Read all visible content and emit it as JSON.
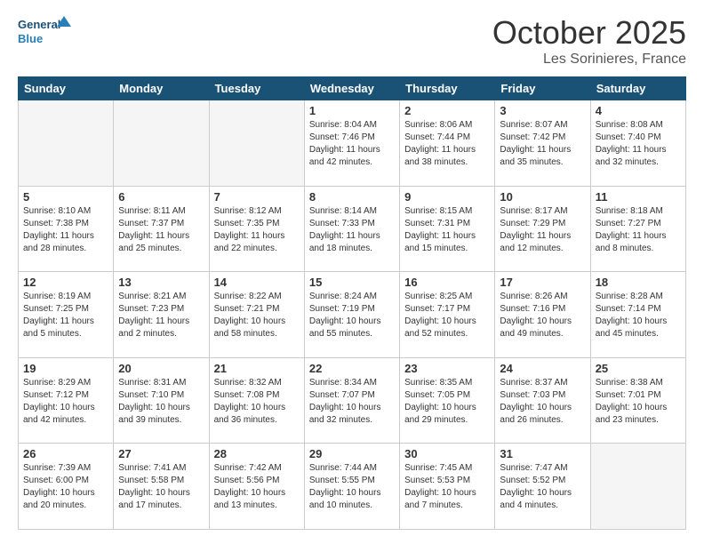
{
  "header": {
    "logo_line1": "General",
    "logo_line2": "Blue",
    "month": "October 2025",
    "location": "Les Sorinieres, France"
  },
  "weekdays": [
    "Sunday",
    "Monday",
    "Tuesday",
    "Wednesday",
    "Thursday",
    "Friday",
    "Saturday"
  ],
  "days": [
    {
      "num": "",
      "info": ""
    },
    {
      "num": "",
      "info": ""
    },
    {
      "num": "",
      "info": ""
    },
    {
      "num": "1",
      "info": "Sunrise: 8:04 AM\nSunset: 7:46 PM\nDaylight: 11 hours\nand 42 minutes."
    },
    {
      "num": "2",
      "info": "Sunrise: 8:06 AM\nSunset: 7:44 PM\nDaylight: 11 hours\nand 38 minutes."
    },
    {
      "num": "3",
      "info": "Sunrise: 8:07 AM\nSunset: 7:42 PM\nDaylight: 11 hours\nand 35 minutes."
    },
    {
      "num": "4",
      "info": "Sunrise: 8:08 AM\nSunset: 7:40 PM\nDaylight: 11 hours\nand 32 minutes."
    },
    {
      "num": "5",
      "info": "Sunrise: 8:10 AM\nSunset: 7:38 PM\nDaylight: 11 hours\nand 28 minutes."
    },
    {
      "num": "6",
      "info": "Sunrise: 8:11 AM\nSunset: 7:37 PM\nDaylight: 11 hours\nand 25 minutes."
    },
    {
      "num": "7",
      "info": "Sunrise: 8:12 AM\nSunset: 7:35 PM\nDaylight: 11 hours\nand 22 minutes."
    },
    {
      "num": "8",
      "info": "Sunrise: 8:14 AM\nSunset: 7:33 PM\nDaylight: 11 hours\nand 18 minutes."
    },
    {
      "num": "9",
      "info": "Sunrise: 8:15 AM\nSunset: 7:31 PM\nDaylight: 11 hours\nand 15 minutes."
    },
    {
      "num": "10",
      "info": "Sunrise: 8:17 AM\nSunset: 7:29 PM\nDaylight: 11 hours\nand 12 minutes."
    },
    {
      "num": "11",
      "info": "Sunrise: 8:18 AM\nSunset: 7:27 PM\nDaylight: 11 hours\nand 8 minutes."
    },
    {
      "num": "12",
      "info": "Sunrise: 8:19 AM\nSunset: 7:25 PM\nDaylight: 11 hours\nand 5 minutes."
    },
    {
      "num": "13",
      "info": "Sunrise: 8:21 AM\nSunset: 7:23 PM\nDaylight: 11 hours\nand 2 minutes."
    },
    {
      "num": "14",
      "info": "Sunrise: 8:22 AM\nSunset: 7:21 PM\nDaylight: 10 hours\nand 58 minutes."
    },
    {
      "num": "15",
      "info": "Sunrise: 8:24 AM\nSunset: 7:19 PM\nDaylight: 10 hours\nand 55 minutes."
    },
    {
      "num": "16",
      "info": "Sunrise: 8:25 AM\nSunset: 7:17 PM\nDaylight: 10 hours\nand 52 minutes."
    },
    {
      "num": "17",
      "info": "Sunrise: 8:26 AM\nSunset: 7:16 PM\nDaylight: 10 hours\nand 49 minutes."
    },
    {
      "num": "18",
      "info": "Sunrise: 8:28 AM\nSunset: 7:14 PM\nDaylight: 10 hours\nand 45 minutes."
    },
    {
      "num": "19",
      "info": "Sunrise: 8:29 AM\nSunset: 7:12 PM\nDaylight: 10 hours\nand 42 minutes."
    },
    {
      "num": "20",
      "info": "Sunrise: 8:31 AM\nSunset: 7:10 PM\nDaylight: 10 hours\nand 39 minutes."
    },
    {
      "num": "21",
      "info": "Sunrise: 8:32 AM\nSunset: 7:08 PM\nDaylight: 10 hours\nand 36 minutes."
    },
    {
      "num": "22",
      "info": "Sunrise: 8:34 AM\nSunset: 7:07 PM\nDaylight: 10 hours\nand 32 minutes."
    },
    {
      "num": "23",
      "info": "Sunrise: 8:35 AM\nSunset: 7:05 PM\nDaylight: 10 hours\nand 29 minutes."
    },
    {
      "num": "24",
      "info": "Sunrise: 8:37 AM\nSunset: 7:03 PM\nDaylight: 10 hours\nand 26 minutes."
    },
    {
      "num": "25",
      "info": "Sunrise: 8:38 AM\nSunset: 7:01 PM\nDaylight: 10 hours\nand 23 minutes."
    },
    {
      "num": "26",
      "info": "Sunrise: 7:39 AM\nSunset: 6:00 PM\nDaylight: 10 hours\nand 20 minutes."
    },
    {
      "num": "27",
      "info": "Sunrise: 7:41 AM\nSunset: 5:58 PM\nDaylight: 10 hours\nand 17 minutes."
    },
    {
      "num": "28",
      "info": "Sunrise: 7:42 AM\nSunset: 5:56 PM\nDaylight: 10 hours\nand 13 minutes."
    },
    {
      "num": "29",
      "info": "Sunrise: 7:44 AM\nSunset: 5:55 PM\nDaylight: 10 hours\nand 10 minutes."
    },
    {
      "num": "30",
      "info": "Sunrise: 7:45 AM\nSunset: 5:53 PM\nDaylight: 10 hours\nand 7 minutes."
    },
    {
      "num": "31",
      "info": "Sunrise: 7:47 AM\nSunset: 5:52 PM\nDaylight: 10 hours\nand 4 minutes."
    },
    {
      "num": "",
      "info": ""
    }
  ]
}
